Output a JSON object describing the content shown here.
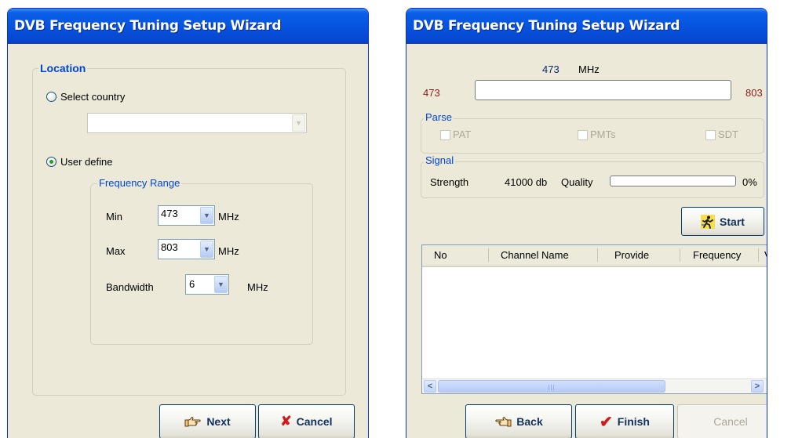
{
  "left_window": {
    "title": "DVB Frequency Tuning Setup Wizard",
    "location_legend": "Location",
    "select_country_label": "Select country",
    "country_value": "",
    "user_define_label": "User define",
    "freq_range_legend": "Frequency Range",
    "min_label": "Min",
    "min_value": "473",
    "max_label": "Max",
    "max_value": "803",
    "bandwidth_label": "Bandwidth",
    "bandwidth_value": "6",
    "unit": "MHz",
    "next_label": "Next",
    "cancel_label": "Cancel",
    "selected_option": "user_define"
  },
  "right_window": {
    "title": "DVB Frequency Tuning Setup Wizard",
    "current_freq": "473",
    "current_unit": "MHz",
    "range_min": "473",
    "range_max": "803",
    "tuning_progress": 0,
    "parse_legend": "Parse",
    "parse_pat": "PAT",
    "parse_pmts": "PMTs",
    "parse_sdt": "SDT",
    "signal_legend": "Signal",
    "strength_label": "Strength",
    "strength_value": "41000 db",
    "quality_label": "Quality",
    "quality_percent": "0%",
    "quality_level": 0,
    "start_label": "Start",
    "columns": [
      "No",
      "Channel Name",
      "Provide",
      "Frequency",
      "V"
    ],
    "back_label": "Back",
    "finish_label": "Finish",
    "cancel_label": "Cancel"
  },
  "icons": {
    "next": "pointing-hand-icon",
    "cancel": "red-x-icon",
    "start": "running-man-icon",
    "back": "pointing-hand-left-icon",
    "finish": "red-check-icon"
  },
  "colors": {
    "titlebar": "#0654e0",
    "window_bg": "#ece9d8",
    "legend_blue": "#0046d5",
    "range_red": "#8b1a1a"
  }
}
